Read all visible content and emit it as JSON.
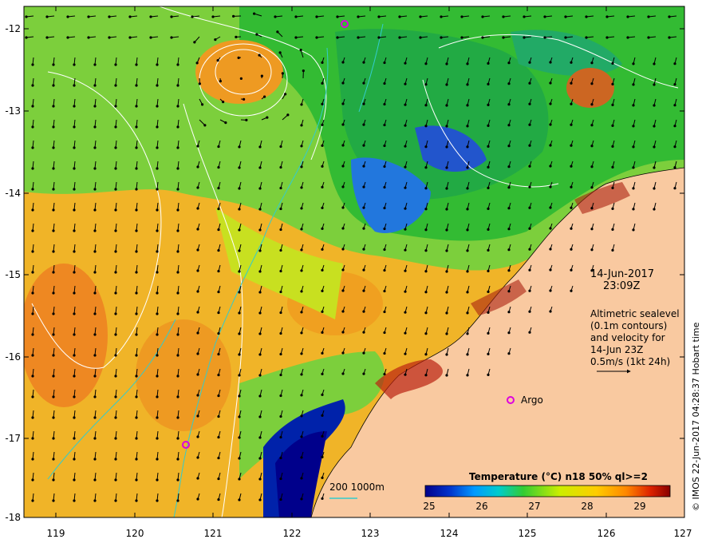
{
  "date_line": "14-Jun-2017",
  "time_line": "23:09Z",
  "altimetry_note": [
    "Altimetric sealevel",
    "(0.1m contours)",
    "and velocity for",
    "14-Jun 23Z",
    "0.5m/s (1kt 24h)"
  ],
  "legend": {
    "title": "Temperature (°C) n18 50% ql>=2",
    "ticks": [
      "25",
      "26",
      "27",
      "28",
      "29"
    ],
    "colors": [
      "#00008b",
      "#0033cc",
      "#0099ff",
      "#00cccc",
      "#33cc33",
      "#ccee00",
      "#ffcc00",
      "#ff8800",
      "#dd2200",
      "#880000"
    ]
  },
  "depth_label": "200  1000m",
  "argo_label": "Argo",
  "credit": "© IMOS 22-Jun-2017 04:28:37 Hobart time",
  "axes": {
    "x_ticks": [
      "119",
      "120",
      "121",
      "122",
      "123",
      "124",
      "125",
      "126",
      "127"
    ],
    "y_ticks": [
      "-12",
      "-13",
      "-14",
      "-15",
      "-16",
      "-17",
      "-18"
    ]
  },
  "colors": {
    "land": "#f9c9a0",
    "contour": "#ffffff",
    "bathymetry": "#33cccc",
    "argo": "#dd00dd",
    "coast": "#000000"
  }
}
